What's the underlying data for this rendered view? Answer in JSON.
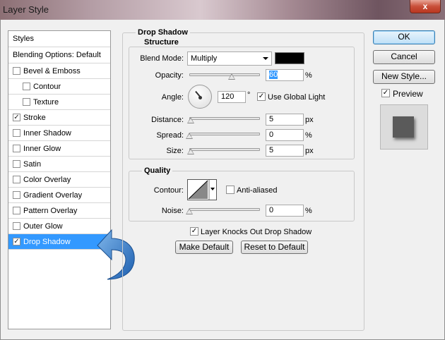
{
  "window": {
    "title": "Layer Style",
    "close_label": "x"
  },
  "styles_list": {
    "items": [
      {
        "label": "Styles",
        "checkbox": false,
        "checked": false,
        "selected": false
      },
      {
        "label": "Blending Options: Default",
        "checkbox": false,
        "checked": false,
        "selected": false
      },
      {
        "label": "Bevel & Emboss",
        "checkbox": true,
        "checked": false,
        "selected": false
      },
      {
        "label": "Contour",
        "checkbox": true,
        "checked": false,
        "selected": false,
        "indent": true
      },
      {
        "label": "Texture",
        "checkbox": true,
        "checked": false,
        "selected": false,
        "indent": true
      },
      {
        "label": "Stroke",
        "checkbox": true,
        "checked": true,
        "selected": false
      },
      {
        "label": "Inner Shadow",
        "checkbox": true,
        "checked": false,
        "selected": false
      },
      {
        "label": "Inner Glow",
        "checkbox": true,
        "checked": false,
        "selected": false
      },
      {
        "label": "Satin",
        "checkbox": true,
        "checked": false,
        "selected": false
      },
      {
        "label": "Color Overlay",
        "checkbox": true,
        "checked": false,
        "selected": false
      },
      {
        "label": "Gradient Overlay",
        "checkbox": true,
        "checked": false,
        "selected": false
      },
      {
        "label": "Pattern Overlay",
        "checkbox": true,
        "checked": false,
        "selected": false
      },
      {
        "label": "Outer Glow",
        "checkbox": true,
        "checked": false,
        "selected": false
      },
      {
        "label": "Drop Shadow",
        "checkbox": true,
        "checked": true,
        "selected": true
      }
    ]
  },
  "drop_shadow": {
    "heading": "Drop Shadow",
    "structure": {
      "heading": "Structure",
      "blend_mode_label": "Blend Mode:",
      "blend_mode_value": "Multiply",
      "shadow_color": "#000000",
      "opacity_label": "Opacity:",
      "opacity_value": "60",
      "opacity_unit": "%",
      "opacity_level": 0.6,
      "angle_label": "Angle:",
      "angle_value": "120",
      "angle_unit": "°",
      "use_global_light_label": "Use Global Light",
      "use_global_light_checked": true,
      "distance_label": "Distance:",
      "distance_value": "5",
      "distance_unit": "px",
      "distance_level": 0.02,
      "spread_label": "Spread:",
      "spread_value": "0",
      "spread_unit": "%",
      "spread_level": 0.0,
      "size_label": "Size:",
      "size_value": "5",
      "size_unit": "px",
      "size_level": 0.02
    },
    "quality": {
      "heading": "Quality",
      "contour_label": "Contour:",
      "anti_aliased_label": "Anti-aliased",
      "anti_aliased_checked": false,
      "noise_label": "Noise:",
      "noise_value": "0",
      "noise_unit": "%",
      "noise_level": 0.0
    },
    "knockout_label": "Layer Knocks Out Drop Shadow",
    "knockout_checked": true,
    "make_default_label": "Make Default",
    "reset_default_label": "Reset to Default"
  },
  "actions": {
    "ok_label": "OK",
    "cancel_label": "Cancel",
    "new_style_label": "New Style...",
    "preview_label": "Preview",
    "preview_checked": true
  },
  "check_glyph": "✓"
}
